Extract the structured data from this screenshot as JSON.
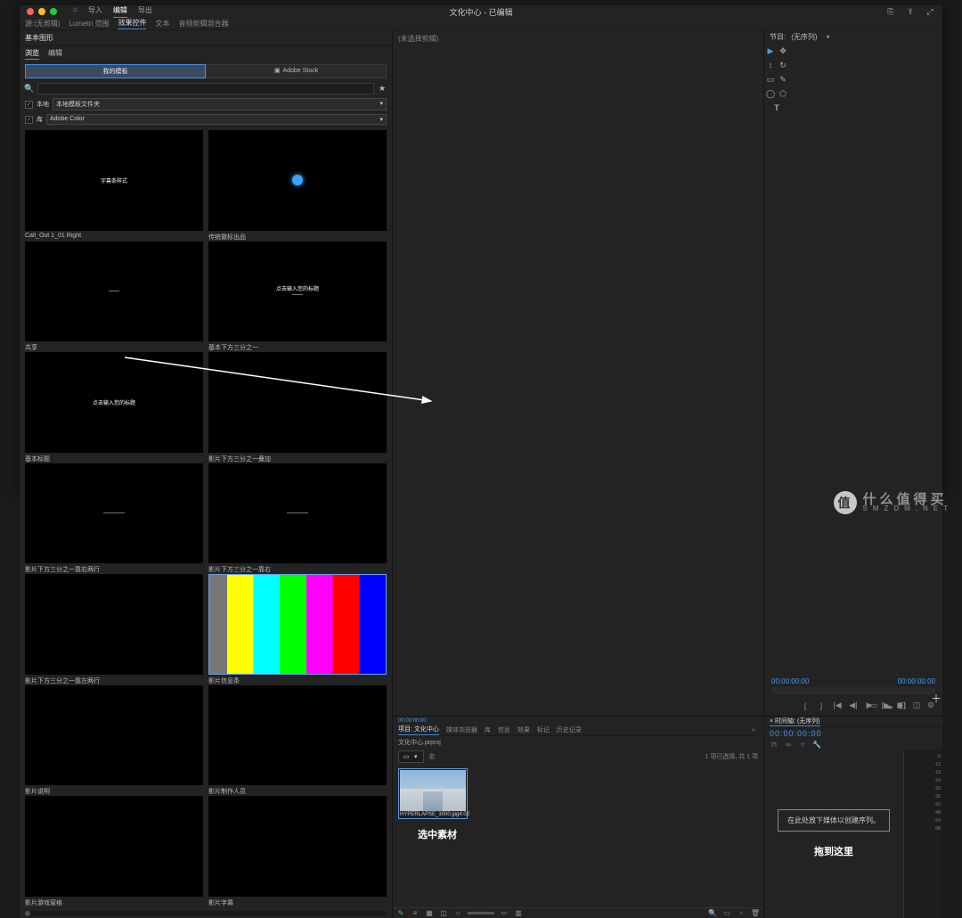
{
  "titlebar": {
    "nav": {
      "home": "⌂",
      "import": "导入",
      "edit": "编辑",
      "export": "导出"
    },
    "title": "文化中心 - 已编辑",
    "right_icons": [
      "bell-icon",
      "share-icon",
      "fullscreen-icon"
    ]
  },
  "workspace_tabs": {
    "t1": "源:(无剪辑)",
    "t2": "Lumetri 范围",
    "t3": "效果控件",
    "t4": "文本",
    "t5": "音频剪辑混合器"
  },
  "topleft": {
    "empty_hint": "(未选择剪辑)"
  },
  "program": {
    "title_prefix": "节目:",
    "seq_name": "(无序列)",
    "tc_left": "00:00:00:00",
    "tc_right": "00:00:00:00"
  },
  "essential_graphics": {
    "panel_title": "基本图形",
    "subtab_browse": "浏览",
    "subtab_edit": "编辑",
    "template_tab_mine": "我的模板",
    "template_tab_stock": "Adobe Stock",
    "search_placeholder": "",
    "filter_local_label": "本地",
    "filter_local_value": "本地模板文件夹",
    "filter_lib_label": "库",
    "filter_lib_value": "Adobe Color",
    "items": [
      {
        "label": "Call_Out 1_01 Right",
        "thumb_text": "字幕条样式"
      },
      {
        "label": "传统徽标出品",
        "thumb_text": "●"
      },
      {
        "label": "共享",
        "thumb_text": "——"
      },
      {
        "label": "基本下方三分之一",
        "thumb_text": "点击输入您的标题\n——"
      },
      {
        "label": "基本标题",
        "thumb_text": "点击输入您的标题"
      },
      {
        "label": "影片下方三分之一叠加",
        "thumb_text": ""
      },
      {
        "label": "影片下方三分之一靠右两行",
        "thumb_text": "————"
      },
      {
        "label": "影片下方三分之一靠右",
        "thumb_text": "————"
      },
      {
        "label": "影片下方三分之一靠左两行",
        "thumb_text": ""
      },
      {
        "label": "影片信息条",
        "thumb_text": ""
      },
      {
        "label": "影片说明",
        "thumb_text": ""
      },
      {
        "label": "影片制作人员",
        "thumb_text": ""
      },
      {
        "label": "影片游戏窗格",
        "thumb_text": ""
      },
      {
        "label": "影片字幕",
        "thumb_text": ""
      }
    ]
  },
  "project": {
    "tc_small": "00:00:00:00",
    "tabs": {
      "project": "项目: 文化中心",
      "browser": "媒体浏览器",
      "lib": "库",
      "info": "信息",
      "effects": "效果",
      "markers": "标记",
      "history": "历史记录"
    },
    "proj_name": "文化中心.prproj",
    "bin_col": "名",
    "selection_info": "1 项已选择, 共 1 项",
    "clip_name": "HYPERLAPSE_3000.jpg",
    "clip_dur": "4:02",
    "anno_select": "选中素材"
  },
  "timeline": {
    "tab": "× 时间轴:",
    "seq": "(无序列)",
    "tc": "00:00:00:00",
    "drop_text": "在此处放下媒体以创建序列。",
    "drop_anno": "拖到这里",
    "meter_ticks": [
      "-6",
      "-12",
      "-18",
      "-24",
      "-30",
      "-36",
      "-42",
      "-48",
      "-54",
      "dB"
    ]
  },
  "watermark": {
    "badge": "值",
    "text": "什么值得买\nSMZDM"
  },
  "colors": {
    "accent": "#3f8de0",
    "tc": "#4a9af0"
  }
}
